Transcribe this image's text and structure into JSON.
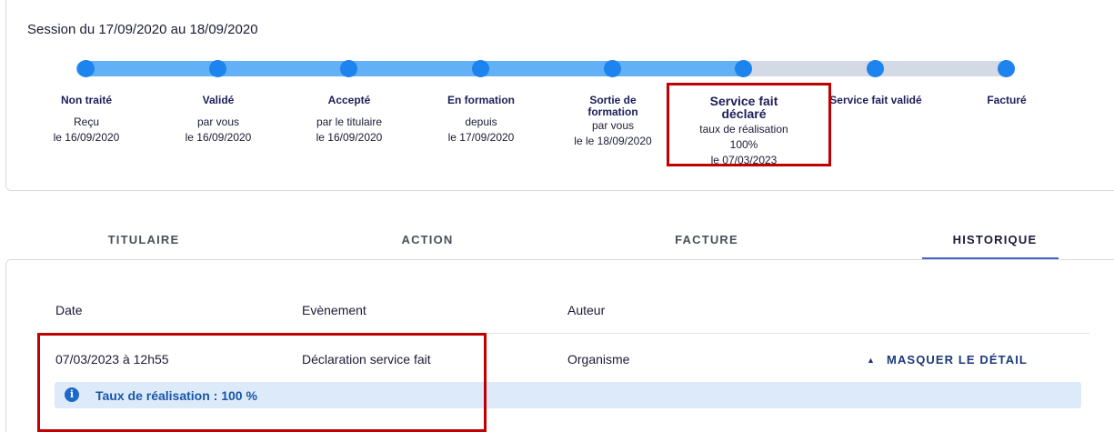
{
  "session": {
    "title": "Session du 17/09/2020 au 18/09/2020",
    "steps": [
      {
        "title": "Non traité",
        "line1": "Reçu",
        "line2": "le 16/09/2020"
      },
      {
        "title": "Validé",
        "line1": "par vous",
        "line2": "le 16/09/2020"
      },
      {
        "title": "Accepté",
        "line1": "par le titulaire",
        "line2": "le 16/09/2020"
      },
      {
        "title": "En formation",
        "line1": "depuis",
        "line2": "le 17/09/2020"
      },
      {
        "title_l1": "Sortie de",
        "title_l2": "formation",
        "line1": "par vous",
        "line2": "le le 18/09/2020"
      },
      {
        "title_l1": "Service fait",
        "title_l2": "déclaré",
        "line1": "taux de réalisation 100%",
        "line2": "le 07/03/2023"
      },
      {
        "title": "Service fait validé"
      },
      {
        "title": "Facturé"
      }
    ],
    "progress": {
      "completed_steps": 6,
      "total_steps": 8
    },
    "colors": {
      "completed_dot": "#1d83ee",
      "completed_track": "#62b0f5",
      "pending_track": "#d4d9e6",
      "highlight": "#c00000"
    }
  },
  "tabs": [
    {
      "label": "TITULAIRE",
      "active": false
    },
    {
      "label": "ACTION",
      "active": false
    },
    {
      "label": "FACTURE",
      "active": false
    },
    {
      "label": "HISTORIQUE",
      "active": true
    }
  ],
  "history": {
    "headers": {
      "date": "Date",
      "event": "Evènement",
      "author": "Auteur"
    },
    "rows": [
      {
        "date": "07/03/2023 à 12h55",
        "event": "Déclaration service fait",
        "author": "Organisme",
        "toggle_label": "MASQUER LE DÉTAIL",
        "detail": "Taux de réalisation : 100 %"
      }
    ]
  },
  "icons": {
    "info": "info-icon",
    "caret": "caret-up-icon"
  }
}
